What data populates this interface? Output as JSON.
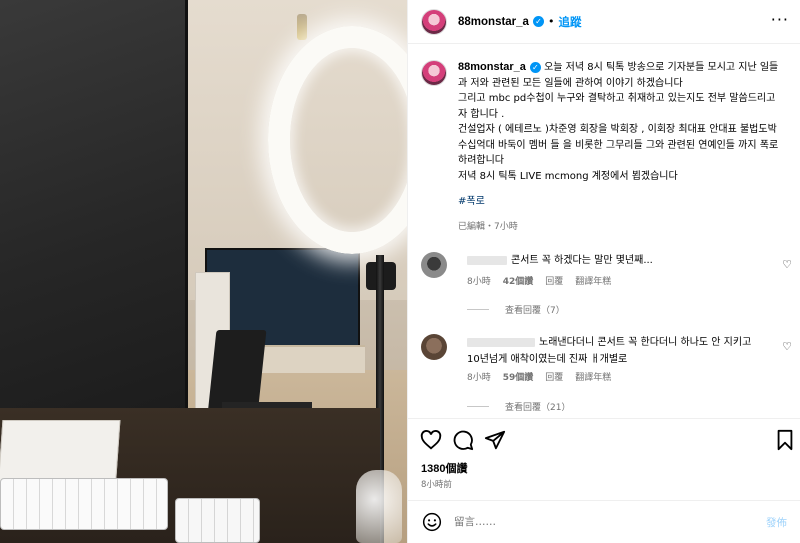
{
  "header": {
    "username": "88monstar_a",
    "follow_label": "追蹤",
    "separator": "•",
    "more_label": "···"
  },
  "caption": {
    "username": "88monstar_a",
    "text": "오늘 저녁 8시 틱톡 방송으로 기자분들 모시고 지난 일들과 저와 관련된 모든 일들에 관하여 이야기 하겠습니다\n그리고 mbc pd수첩이 누구와 결탁하고 취재하고 있는지도 전부 말씀드리고자 합니다 .\n건설업자 ( 에테르노 )차준영 회장을 박회장 , 이회장 최대표 안대표 불법도박 수십억대 바둑이 멤버 들 을 비롯한 그무리들 그와 관련된 연예인들 까지 폭로 하려합니다\n저녁 8시 틱톡 LIVE mcmong 계정에서 뵙겠습니다",
    "hashtag": "#폭로",
    "meta": "已編輯・7小時"
  },
  "comments": [
    {
      "text": "콘서트 꼭 하겠다는 말만 몇년째...",
      "time": "8小時",
      "likes": "42個讚",
      "reply_label": "回覆",
      "translate_label": "翻譯年糕",
      "view_replies": "查看回覆（7）"
    },
    {
      "text": "노래낸다더니 콘서트 꼭 한다더니 하나도 안 지키고 10년넘게 애착이였는데 진짜 ㅐ개별로",
      "time": "8小時",
      "likes": "59個讚",
      "reply_label": "回覆",
      "translate_label": "翻譯年糕",
      "view_replies": "查看回覆（21）"
    }
  ],
  "post": {
    "likes": "1380個讚",
    "time_ago": "8小時前"
  },
  "comment_box": {
    "placeholder": "留言……",
    "post_label": "發佈"
  },
  "icons": {
    "verified": "verified-badge-icon",
    "heart": "heart-icon",
    "comment": "comment-icon",
    "share": "paper-plane-icon",
    "save": "bookmark-icon",
    "emoji": "emoji-icon"
  },
  "colors": {
    "accent": "#0095f6",
    "secondary_text": "#737373",
    "hashtag": "#00376b"
  }
}
